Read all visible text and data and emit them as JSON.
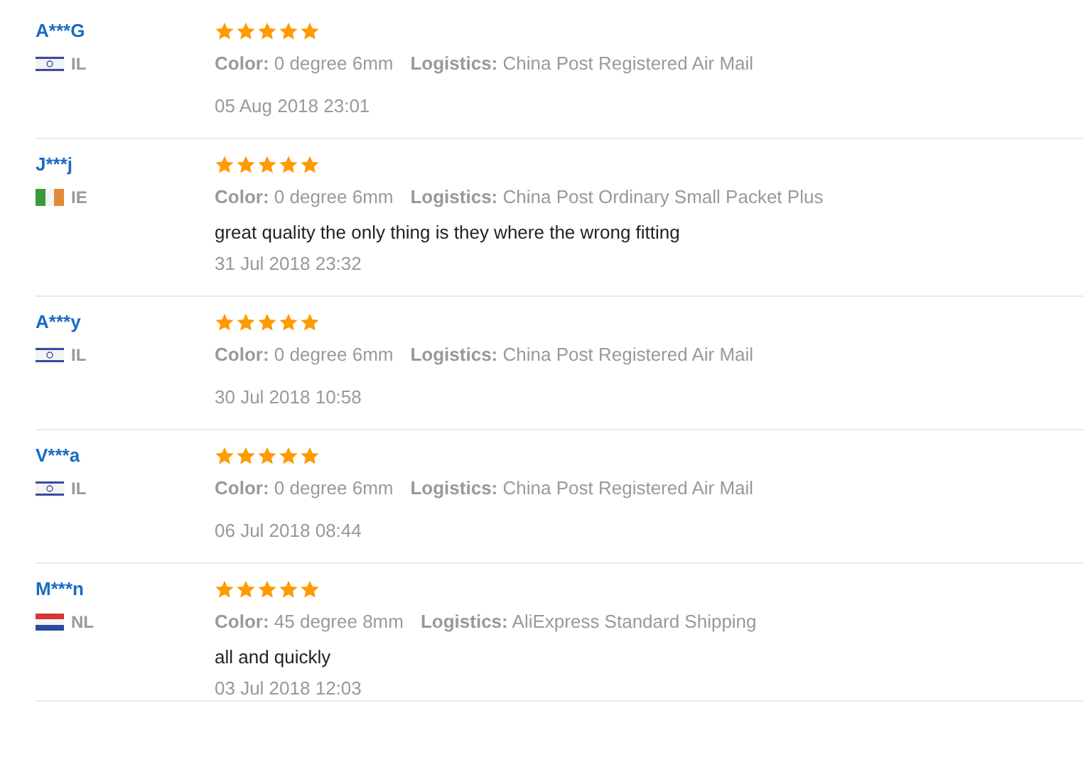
{
  "reviews": [
    {
      "name": "A***G",
      "flag": {
        "kind": "israel"
      },
      "country": "IL",
      "stars": 5,
      "color_label": "Color:",
      "color_value": "0 degree 6mm",
      "logistics_label": "Logistics:",
      "logistics_value": "China Post Registered Air Mail",
      "date": "05 Aug 2018 23:01"
    },
    {
      "name": "J***j",
      "flag": {
        "kind": "ireland"
      },
      "country": "IE",
      "stars": 5,
      "color_label": "Color:",
      "color_value": "0 degree 6mm",
      "logistics_label": "Logistics:",
      "logistics_value": "China Post Ordinary Small Packet Plus",
      "comment": "great quality the only thing is they where the wrong fitting",
      "date": "31 Jul 2018 23:32"
    },
    {
      "name": "A***y",
      "flag": {
        "kind": "israel"
      },
      "country": "IL",
      "stars": 5,
      "color_label": "Color:",
      "color_value": "0 degree 6mm",
      "logistics_label": "Logistics:",
      "logistics_value": "China Post Registered Air Mail",
      "date": "30 Jul 2018 10:58"
    },
    {
      "name": "V***a",
      "flag": {
        "kind": "israel"
      },
      "country": "IL",
      "stars": 5,
      "color_label": "Color:",
      "color_value": "0 degree 6mm",
      "logistics_label": "Logistics:",
      "logistics_value": "China Post Registered Air Mail",
      "date": "06 Jul 2018 08:44"
    },
    {
      "name": "M***n",
      "flag": {
        "kind": "netherlands"
      },
      "country": "NL",
      "stars": 5,
      "color_label": "Color:",
      "color_value": "45 degree 8mm",
      "logistics_label": "Logistics:",
      "logistics_value": "AliExpress Standard Shipping",
      "comment": "all and quickly",
      "date": "03 Jul 2018 12:03"
    }
  ]
}
